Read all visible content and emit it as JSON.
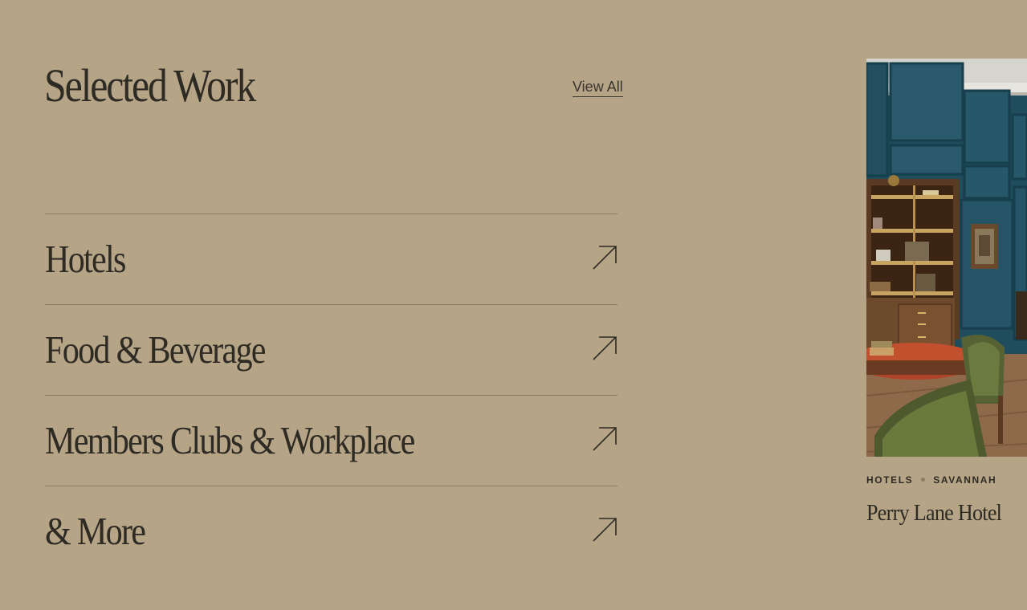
{
  "section": {
    "title": "Selected Work",
    "view_all_label": "View All"
  },
  "categories": [
    {
      "label": "Hotels",
      "icon": "arrow-up-right-icon"
    },
    {
      "label": "Food & Beverage",
      "icon": "arrow-up-right-icon"
    },
    {
      "label": "Members Clubs & Workplace",
      "icon": "arrow-up-right-icon"
    },
    {
      "label": "& More",
      "icon": "arrow-up-right-icon"
    }
  ],
  "featured_card": {
    "tag_1": "HOTELS",
    "tag_2": "SAVANNAH",
    "title": "Perry Lane Hotel"
  },
  "colors": {
    "background": "#b5a586",
    "text": "#2e2a24",
    "divider": "#8a7d66"
  }
}
